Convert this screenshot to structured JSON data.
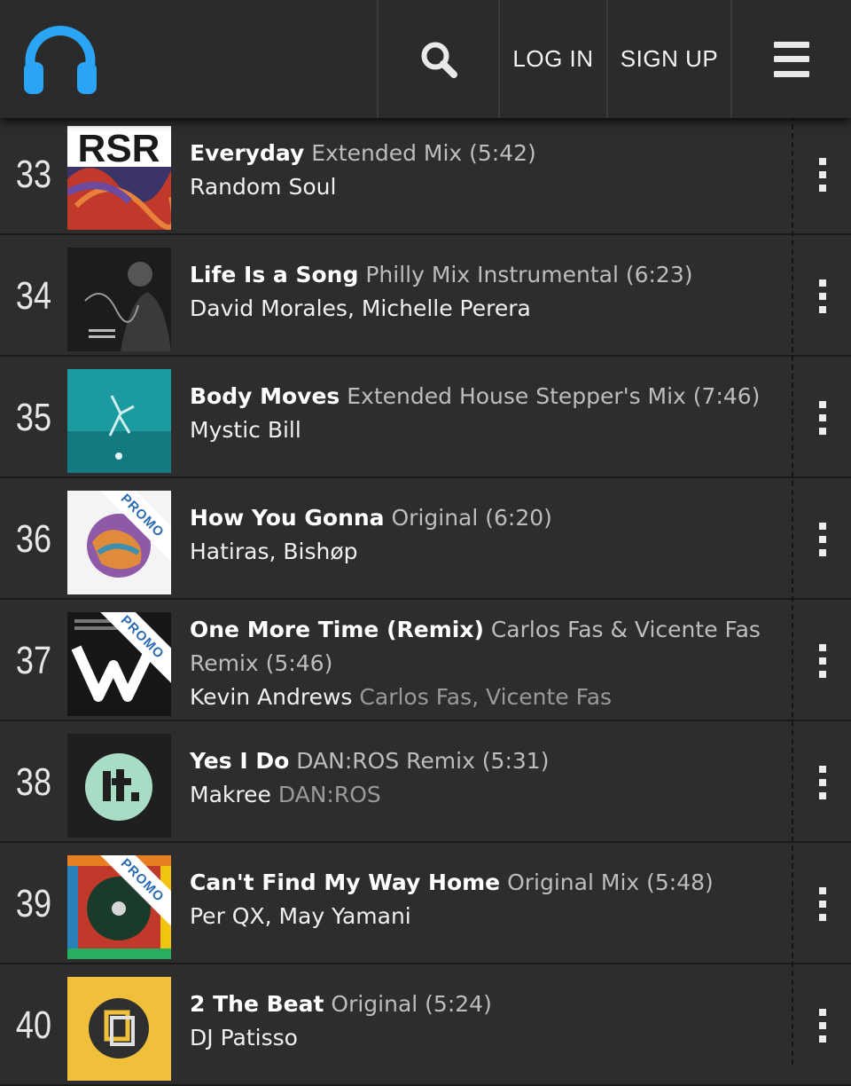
{
  "header": {
    "login_label": "LOG IN",
    "signup_label": "SIGN UP",
    "logo_icon": "headphones-icon",
    "search_icon": "search-icon",
    "menu_icon": "hamburger-menu-icon",
    "brand_color": "#2aa4f4"
  },
  "tracks": [
    {
      "rank": "33",
      "title": "Everyday",
      "mix": "Extended Mix (5:42)",
      "artists": "Random Soul",
      "remixers": "",
      "promo": false
    },
    {
      "rank": "34",
      "title": "Life Is a Song",
      "mix": "Philly Mix Instrumental (6:23)",
      "artists": "David Morales, Michelle Perera",
      "remixers": "",
      "promo": false
    },
    {
      "rank": "35",
      "title": "Body Moves",
      "mix": "Extended House Stepper's Mix (7:46)",
      "artists": "Mystic Bill",
      "remixers": "",
      "promo": false
    },
    {
      "rank": "36",
      "title": "How You Gonna",
      "mix": "Original (6:20)",
      "artists": "Hatiras, Bishøp",
      "remixers": "",
      "promo": true
    },
    {
      "rank": "37",
      "title": "One More Time (Remix)",
      "mix": "Carlos Fas & Vicente Fas Remix (5:46)",
      "artists": "Kevin Andrews",
      "remixers": "Carlos Fas, Vicente Fas",
      "promo": true
    },
    {
      "rank": "38",
      "title": "Yes I Do",
      "mix": "DAN:ROS Remix (5:31)",
      "artists": "Makree",
      "remixers": "DAN:ROS",
      "promo": false
    },
    {
      "rank": "39",
      "title": "Can't Find My Way Home",
      "mix": "Original Mix (5:48)",
      "artists": "Per QX, May Yamani",
      "remixers": "",
      "promo": true
    },
    {
      "rank": "40",
      "title": "2 The Beat",
      "mix": "Original (5:24)",
      "artists": "DJ Patisso",
      "remixers": "",
      "promo": false
    }
  ],
  "promo_label": "PROMO",
  "cover_texts": {
    "rsr": "RSR"
  }
}
